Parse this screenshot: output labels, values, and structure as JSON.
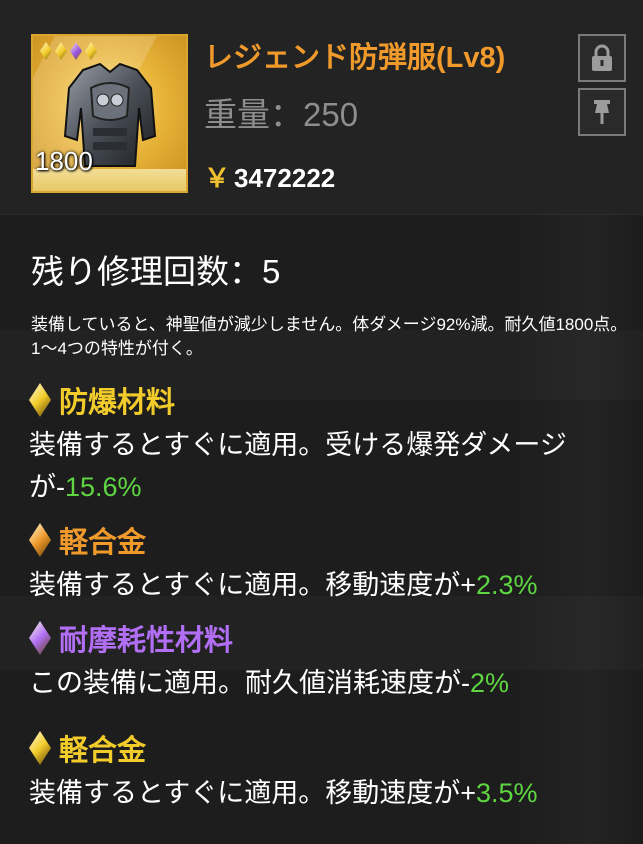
{
  "item": {
    "name": "レジェンド防弾服(Lv8)",
    "weight_label": "重量：250",
    "price_symbol": "￥",
    "price": "3472222",
    "durability": "1800",
    "image_icon": "body-armor-icon",
    "rarity_gems": [
      "#f2cc2a",
      "#f2cc2a",
      "#9a55e8",
      "#f2cc2a"
    ]
  },
  "buttons": {
    "lock_icon": "lock-icon",
    "pin_icon": "pin-icon"
  },
  "repair_label": "残り修理回数：5",
  "description": "装備していると、神聖値が減少しません。体ダメージ92%減。耐久値1800点。1〜4つの特性が付く。",
  "traits": [
    {
      "title": "防爆材料",
      "color": "#f2cc2a",
      "text_prefix": "装備するとすぐに適用。受ける爆発ダメージが-",
      "value": "15.6%"
    },
    {
      "title": "軽合金",
      "color": "#f09a2c",
      "text_prefix": "装備するとすぐに適用。移動速度が+",
      "value": "2.3%"
    },
    {
      "title": "耐摩耗性材料",
      "color": "#b26ff5",
      "text_prefix": "この装備に適用。耐久値消耗速度が-",
      "value": "2%"
    },
    {
      "title": "軽合金",
      "color": "#f2cc2a",
      "text_prefix": "装備するとすぐに適用。移動速度が+",
      "value": "3.5%"
    }
  ]
}
